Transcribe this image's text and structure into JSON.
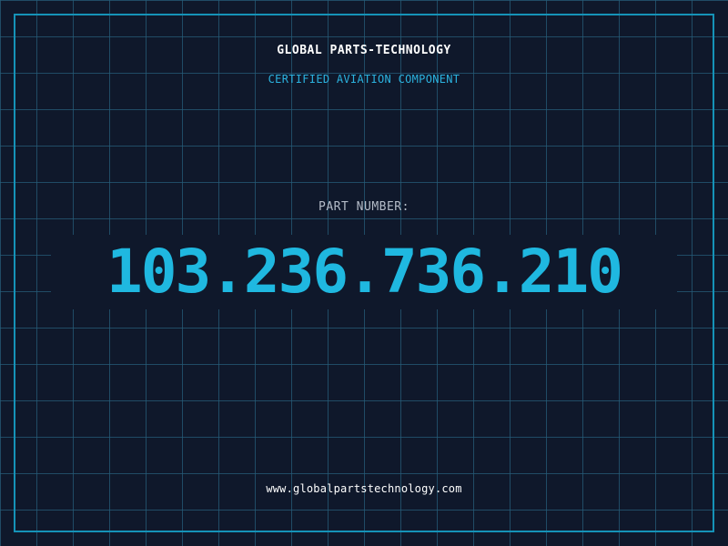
{
  "header": {
    "company": "GLOBAL PARTS-TECHNOLOGY",
    "subtitle": "CERTIFIED AVIATION COMPONENT"
  },
  "part": {
    "label": "PART NUMBER:",
    "number": "103.236.736.210"
  },
  "footer": {
    "website": "www.globalpartstechnology.com"
  },
  "colors": {
    "background": "#0f182b",
    "grid": "#265c78",
    "frame": "#1593b8",
    "accent": "#1fb8e0",
    "label": "#b4bcc8",
    "text": "#ffffff"
  }
}
